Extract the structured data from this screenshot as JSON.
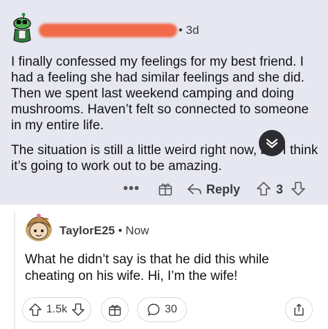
{
  "parent_comment": {
    "time": "• 3d",
    "paragraphs": [
      "I finally confessed my feelings for my best friend. I had a feeling she had similar feelings and she did. Then we spent last weekend camping and doing mushrooms. Haven’t felt so connected to someone in my entire life.",
      "The situation is still a little weird right now, but I think it’s going to work out to be amazing."
    ],
    "actions": {
      "more": "•••",
      "reply_label": "Reply",
      "score": "3"
    }
  },
  "reply_comment": {
    "username": "TaylorE25",
    "time": "• Now",
    "body": "What he didn’t say is that he did this while cheating on his wife. Hi, I’m the wife!",
    "actions": {
      "votes": "1.5k",
      "comments": "30"
    }
  },
  "colors": {
    "parent_background": "#e6e7f1",
    "redaction": "#f26a4a",
    "collapse_button": "#2b2d31"
  }
}
